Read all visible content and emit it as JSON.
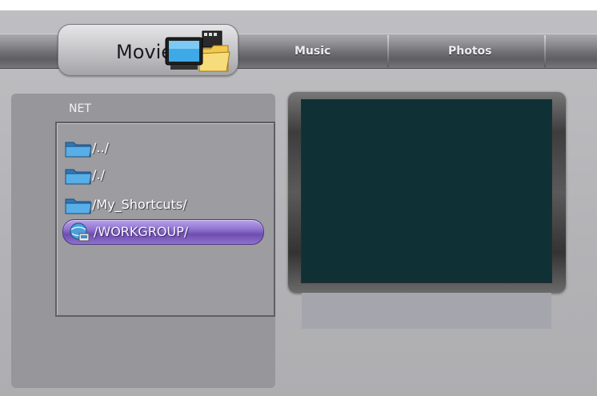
{
  "nav": {
    "active_tab": "Movies",
    "tabs": [
      "Music",
      "Photos"
    ]
  },
  "browser": {
    "location": "NET",
    "items": [
      {
        "label": "/../",
        "icon": "folder-icon"
      },
      {
        "label": "/./",
        "icon": "folder-icon"
      },
      {
        "label": "/My_Shortcuts/",
        "icon": "folder-icon"
      },
      {
        "label": "/WORKGROUP/",
        "icon": "network-icon",
        "selected": true
      }
    ]
  },
  "colors": {
    "selection": "#8f71cf",
    "preview_screen": "#0f3136",
    "folder": "#4fa3df"
  }
}
